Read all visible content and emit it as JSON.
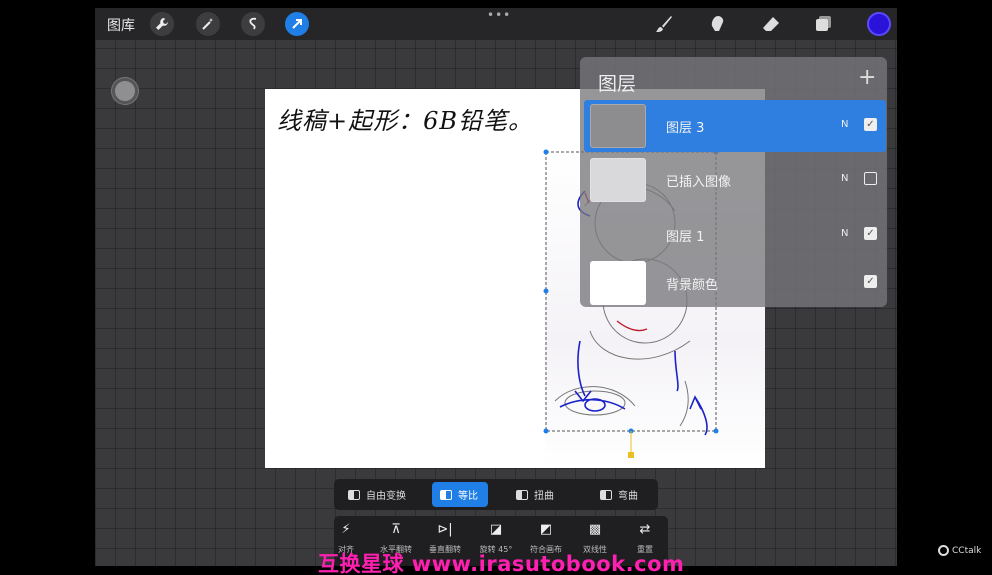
{
  "topbar": {
    "gallery_label": "图库",
    "tools_left": [
      {
        "icon": "wrench-icon",
        "glyph": "🔧"
      },
      {
        "icon": "magic-wand-icon",
        "glyph": "✦"
      },
      {
        "icon": "selection-icon",
        "glyph": "S"
      },
      {
        "icon": "transform-arrow-icon",
        "glyph": "➚",
        "active": true
      }
    ],
    "more_dots": "•••",
    "tools_right": [
      "brush-icon",
      "smudge-icon",
      "eraser-icon",
      "layers-icon"
    ],
    "current_color": "#2a12d8"
  },
  "canvas": {
    "handwriting_text": "线稿+起形：6B铅笔。"
  },
  "layers": {
    "title": "图层",
    "add": "+",
    "items": [
      {
        "name": "图层 3",
        "mode": "N",
        "visible": true,
        "selected": true
      },
      {
        "name": "已插入图像",
        "mode": "N",
        "visible": false,
        "selected": false
      },
      {
        "name": "图层 1",
        "mode": "N",
        "visible": true,
        "selected": false
      },
      {
        "name": "背景颜色",
        "mode": "",
        "visible": true,
        "selected": false
      }
    ]
  },
  "transform_modes": [
    {
      "label": "自由变换",
      "active": false
    },
    {
      "label": "等比",
      "active": true
    },
    {
      "label": "扭曲",
      "active": false
    },
    {
      "label": "弯曲",
      "active": false
    }
  ],
  "actions": [
    {
      "label": "对齐",
      "glyph": "⚡"
    },
    {
      "label": "水平翻转",
      "glyph": "⊼"
    },
    {
      "label": "垂直翻转",
      "glyph": "⊳|"
    },
    {
      "label": "旋转 45°",
      "glyph": "◪"
    },
    {
      "label": "符合画布",
      "glyph": "◩"
    },
    {
      "label": "双线性",
      "glyph": "▩"
    },
    {
      "label": "重置",
      "glyph": "⇄"
    }
  ],
  "watermark": "互换星球 www.irasutobook.com",
  "cctalk_label": "CCtalk",
  "colors": {
    "accent": "#1f7fe6",
    "watermark": "#ff1fb0",
    "sketch_blue": "#1a22c8"
  }
}
